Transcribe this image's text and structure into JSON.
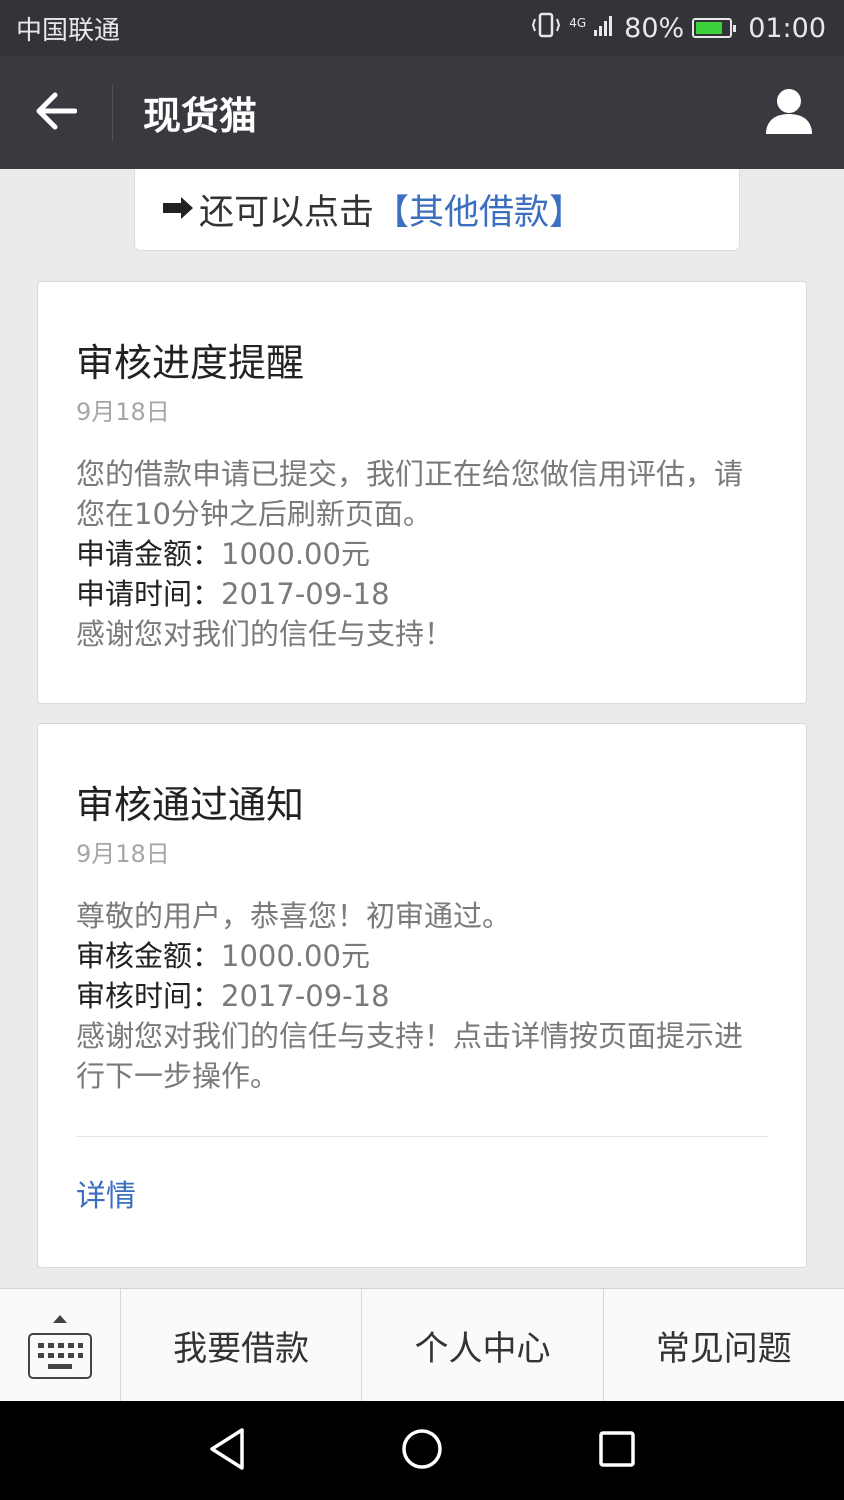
{
  "status_bar": {
    "carrier": "中国联通",
    "network": "4G",
    "battery": "80%",
    "time": "01:00"
  },
  "title_bar": {
    "title": "现货猫"
  },
  "partial_card": {
    "prefix": "还可以点击",
    "link": "【其他借款】"
  },
  "cards": [
    {
      "title": "审核进度提醒",
      "date": "9月18日",
      "intro": "您的借款申请已提交，我们正在给您做信用评估，请您在10分钟之后刷新页面。",
      "rows": [
        {
          "label": "申请金额：",
          "value": "1000.00元"
        },
        {
          "label": "申请时间：",
          "value": "2017-09-18"
        }
      ],
      "closing": "感谢您对我们的信任与支持！"
    },
    {
      "title": "审核通过通知",
      "date": "9月18日",
      "intro": "尊敬的用户，恭喜您！初审通过。",
      "rows": [
        {
          "label": "审核金额：",
          "value": "1000.00元"
        },
        {
          "label": "审核时间：",
          "value": "2017-09-18"
        }
      ],
      "closing": "感谢您对我们的信任与支持！点击详情按页面提示进行下一步操作。",
      "detail_link": "详情"
    }
  ],
  "menu": {
    "items": [
      "我要借款",
      "个人中心",
      "常见问题"
    ]
  },
  "colors": {
    "status_bar_bg": "#333438",
    "title_bar_bg": "#393a3f",
    "link_blue": "#3c6fc0",
    "battery_green": "#3ad13a"
  }
}
